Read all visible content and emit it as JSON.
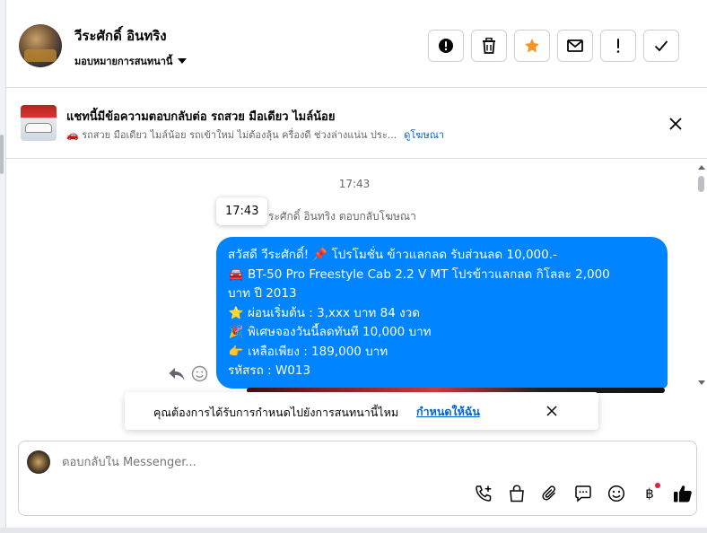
{
  "header": {
    "contact_name": "วีระศักดิ์ อินทริง",
    "assign_label": "มอบหมายการสนทนานี้",
    "actions": [
      {
        "name": "report-button",
        "icon": "alert-circle-icon"
      },
      {
        "name": "delete-button",
        "icon": "trash-icon"
      },
      {
        "name": "star-button",
        "icon": "star-icon"
      },
      {
        "name": "mark-unread-button",
        "icon": "envelope-icon"
      },
      {
        "name": "priority-button",
        "icon": "exclamation-icon"
      },
      {
        "name": "done-button",
        "icon": "check-icon"
      }
    ]
  },
  "ad_banner": {
    "title": "แชทนี้มีข้อความตอบกลับต่อ รถสวย มือเดียว ไมล์น้อย",
    "subtitle": "🚗 รถสวย มือเดียว ไมล์น้อย รถเข้าใหม่ ไม่ต้องลุ้น ครื่องดี ช่วงล่างแน่น ประ...",
    "link": "ดูโฆษณา"
  },
  "thread": {
    "timestamp": "17:43",
    "tooltip_time": "17:43",
    "reply_note": "ระศักดิ์ อินทริง ตอบกลับโฆษณา",
    "bubble_lines": [
      {
        "emoji": "",
        "text": "สวัสดี วีระศักดิ์! 📌 โปรโมชั่น ข้าวแลกลด รับส่วนลด 10,000.-"
      },
      {
        "emoji": "🚘",
        "text": "BT-50 Pro Freestyle Cab 2.2 V MT โปรข้าวแลกลด กิโลละ 2,000"
      },
      {
        "emoji": "",
        "text": "บาท ปี 2013"
      },
      {
        "emoji": "⭐",
        "text": "ผ่อนเริ่มต้น : 3,xxx บาท 84 งวด"
      },
      {
        "emoji": "🎉",
        "text": "พิเศษจองวันนี้ลดทันที 10,000 บาท"
      },
      {
        "emoji": "👉",
        "text": "เหลือเพียง : 189,000 บาท"
      },
      {
        "emoji": "",
        "text": "รหัสรถ : W013"
      }
    ]
  },
  "notify": {
    "text": "คุณต้องการได้รับการกำหนดไปยังการสนทนานี้ไหม",
    "link": "กำหนดให้ฉัน"
  },
  "composer": {
    "placeholder": "ตอบกลับใน Messenger...",
    "tools": [
      "call-add-icon",
      "shop-bag-icon",
      "paperclip-icon",
      "chat-icon",
      "emoji-icon",
      "baht-icon",
      "thumbs-up-icon"
    ],
    "baht_symbol": "฿"
  },
  "colors": {
    "bubble": "#0084ff",
    "link": "#0064d1",
    "star": "#f7931e",
    "red_dot": "#e41e3f"
  }
}
